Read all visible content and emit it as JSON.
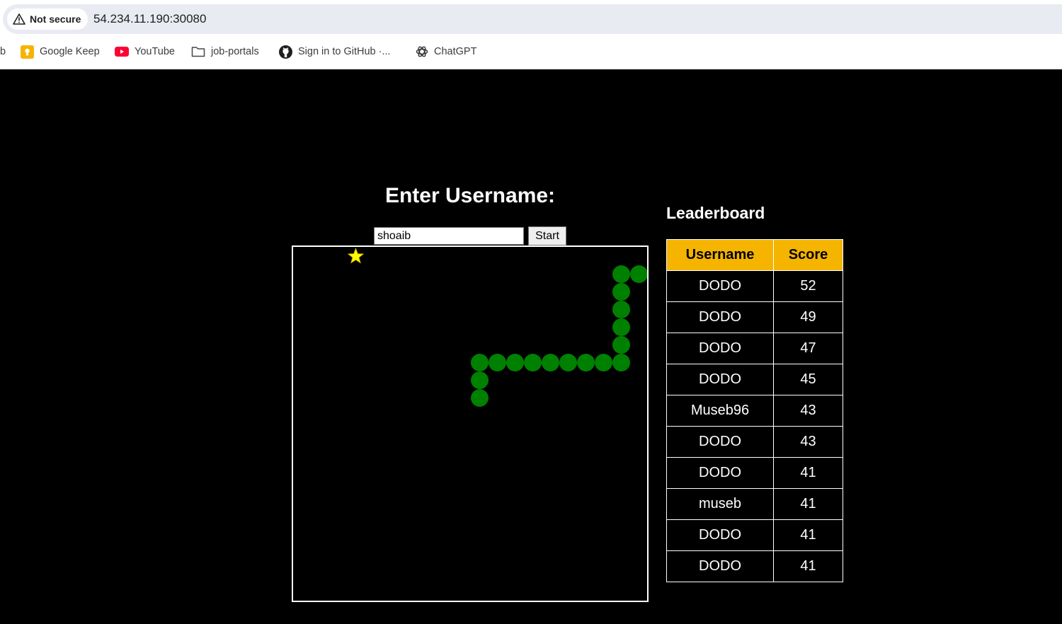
{
  "browser": {
    "security_label": "Not secure",
    "url": "54.234.11.190:30080",
    "bookmarks": [
      {
        "label": "Google Keep",
        "icon": "google-keep-icon"
      },
      {
        "label": "YouTube",
        "icon": "youtube-icon"
      },
      {
        "label": "job-portals",
        "icon": "folder-icon"
      },
      {
        "label": "Sign in to GitHub ·...",
        "icon": "github-icon"
      },
      {
        "label": "ChatGPT",
        "icon": "chatgpt-icon"
      }
    ],
    "truncated_left_fragment": "b"
  },
  "game": {
    "heading": "Enter Username:",
    "username_value": "shoaib",
    "start_label": "Start",
    "colors": {
      "snake": "#008000",
      "food": "#ffff00",
      "border": "#ffffff",
      "background": "#000000"
    },
    "grid_cell": 25,
    "food_cell": [
      3,
      0
    ],
    "snake_cells": [
      [
        19,
        1
      ],
      [
        18,
        1
      ],
      [
        18,
        2
      ],
      [
        18,
        3
      ],
      [
        18,
        4
      ],
      [
        18,
        5
      ],
      [
        18,
        6
      ],
      [
        17,
        6
      ],
      [
        16,
        6
      ],
      [
        15,
        6
      ],
      [
        14,
        6
      ],
      [
        13,
        6
      ],
      [
        12,
        6
      ],
      [
        11,
        6
      ],
      [
        10,
        6
      ],
      [
        10,
        7
      ],
      [
        10,
        8
      ]
    ]
  },
  "leaderboard": {
    "title": "Leaderboard",
    "columns": [
      "Username",
      "Score"
    ],
    "header_color": "#f5b400",
    "rows": [
      {
        "username": "DODO",
        "score": "52"
      },
      {
        "username": "DODO",
        "score": "49"
      },
      {
        "username": "DODO",
        "score": "47"
      },
      {
        "username": "DODO",
        "score": "45"
      },
      {
        "username": "Museb96",
        "score": "43"
      },
      {
        "username": "DODO",
        "score": "43"
      },
      {
        "username": "DODO",
        "score": "41"
      },
      {
        "username": "museb",
        "score": "41"
      },
      {
        "username": "DODO",
        "score": "41"
      },
      {
        "username": "DODO",
        "score": "41"
      }
    ]
  }
}
